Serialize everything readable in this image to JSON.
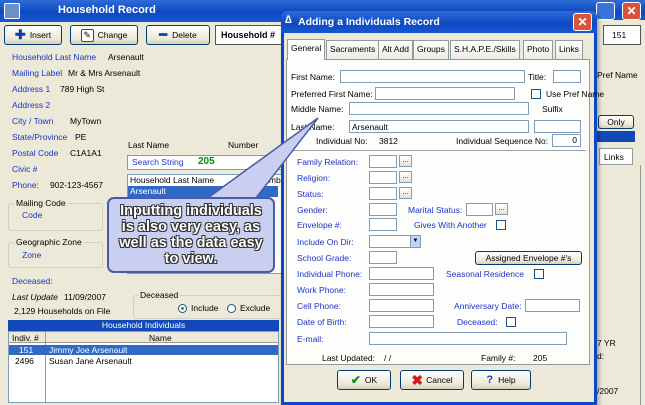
{
  "main_window": {
    "title": "Household Record",
    "toolbar": {
      "insert": "Insert",
      "change": "Change",
      "delete": "Delete",
      "tab_household": "Household #"
    },
    "fields": {
      "last_name_label": "Household Last Name",
      "last_name_value": "Arsenault",
      "mailing_label": "Mailing Label",
      "mailing_value": "Mr & Mrs Arsenault",
      "address1_label": "Address 1",
      "address1_value": "789 High St",
      "address2_label": "Address 2",
      "city_label": "City / Town",
      "city_value": "MyTown",
      "state_label": "State/Province",
      "state_value": "PE",
      "postal_label": "Postal Code",
      "postal_value": "C1A1A1",
      "civic_label": "Civic #",
      "phone_label": "Phone:",
      "phone_value": "902-123-4567",
      "mailing_code_group": "Mailing Code",
      "code_label": "Code",
      "geo_group": "Geographic Zone",
      "zone_label": "Zone",
      "deceased_label": "Deceased:",
      "last_update_label": "Last Update",
      "last_update_value": "11/09/2007",
      "households_on_file": "2,129 Households on File"
    },
    "search": {
      "col_last_name": "Last Name",
      "col_number": "Number",
      "search_string_label": "Search String",
      "search_string_value": "205",
      "list_header_name": "Household Last Name",
      "list_header_num": "Numbe",
      "selected_item": "Arsenault"
    },
    "deceased_filter": {
      "group_label": "Deceased",
      "include": "Include",
      "exclude": "Exclude"
    },
    "individuals": {
      "title": "Household Individuals",
      "col_indiv": "Indiv. #",
      "col_name": "Name",
      "rows": [
        {
          "num": "151",
          "name": "Jimmy Joe Arsenault"
        },
        {
          "num": "2496",
          "name": "Susan Jane Arsenault"
        }
      ]
    }
  },
  "background_right": {
    "number_box": "151",
    "pref_name": "Pref Name",
    "only_btn": "Only",
    "links_tab": "Links",
    "yr_text": "7 YR",
    "d_text": "d:",
    "year_text": "/2007"
  },
  "dialog": {
    "title": "Adding a Individuals Record",
    "tabs": [
      "General",
      "Sacraments",
      "Alt Add",
      "Groups",
      "S.H.A.P.E./Skills",
      "Photo",
      "Links"
    ],
    "labels": {
      "first_name": "First Name:",
      "title": "Title:",
      "preferred_first": "Preferred First Name:",
      "use_pref_name": "Use Pref Name",
      "middle_name": "Middle Name:",
      "suffix": "Sulfix",
      "last_name": "Last Name:",
      "individual_no": "Individual No:",
      "individual_seq": "Individual Sequence No:",
      "family_relation": "Family Relation:",
      "religion": "Religion:",
      "status": "Status:",
      "gender": "Gender:",
      "marital_status": "Marital Status:",
      "envelope": "Envelope #:",
      "gives_with_another": "Gives With Another",
      "include_on_dir": "Include On Dir:",
      "school_grade": "School Grade:",
      "assigned_envelopes": "Assigned Envelope #'s",
      "individual_phone": "Individual Phone:",
      "seasonal_residence": "Seasonal Residence",
      "work_phone": "Work Phone:",
      "cell_phone": "Cell Phone:",
      "anniversary_date": "Anniversary Date:",
      "date_of_birth": "Date of Birth:",
      "deceased": "Deceased:",
      "email": "E-mail:",
      "last_updated": "Last Updated:",
      "last_updated_value": "/ /",
      "family_no": "Family #:",
      "family_no_value": "205"
    },
    "values": {
      "last_name": "Arsenault",
      "individual_no": "3812",
      "individual_seq": "0"
    },
    "buttons": {
      "ok": "OK",
      "cancel": "Cancel",
      "help": "Help"
    }
  },
  "callout": {
    "text": "Inputting individuals is also very easy, as well as the data easy to view."
  }
}
